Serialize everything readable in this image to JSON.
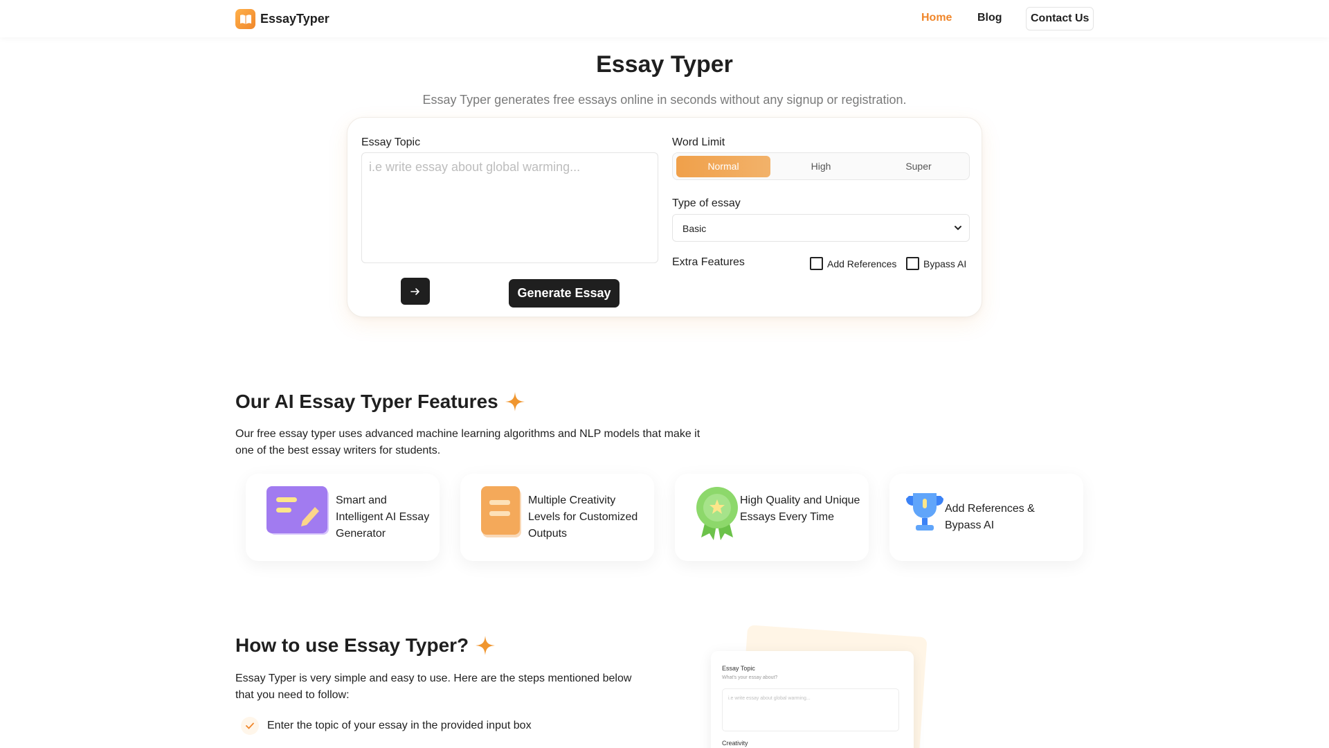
{
  "nav": {
    "brand": "EssayTyper",
    "links": {
      "home": "Home",
      "blog": "Blog",
      "contact": "Contact Us"
    }
  },
  "hero": {
    "title": "Essay Typer",
    "subtitle": "Essay Typer generates free essays online in seconds without any signup or registration."
  },
  "form": {
    "topic_label": "Essay Topic",
    "topic_placeholder": "i.e write essay about global warming...",
    "generate_label": "Generate Essay",
    "word_limit_label": "Word Limit",
    "word_limit_options": [
      "Normal",
      "High",
      "Super"
    ],
    "word_limit_selected": "Normal",
    "type_label": "Type of essay",
    "type_value": "Basic",
    "extra_label": "Extra Features",
    "extra_options": [
      "Add References",
      "Bypass AI"
    ]
  },
  "features": {
    "title": "Our AI Essay Typer Features",
    "description": "Our free essay typer uses advanced machine learning algorithms and NLP models that make it one of the best essay writers for students.",
    "cards": [
      {
        "text": "Smart and Intelligent AI Essay Generator",
        "icon": "document-edit-icon"
      },
      {
        "text": "Multiple Creativity Levels for Customized Outputs",
        "icon": "document-stack-icon"
      },
      {
        "text": "High Quality and Unique Essays Every Time",
        "icon": "award-medal-icon"
      },
      {
        "text": "Add References & Bypass AI",
        "icon": "trophy-icon"
      }
    ]
  },
  "howto": {
    "title": "How to use Essay Typer?",
    "description": "Essay Typer is very simple and easy to use. Here are the steps mentioned below that you need to follow:",
    "steps": [
      "Enter the topic of your essay in the provided input box"
    ],
    "preview": {
      "topic_label": "Essay Topic",
      "topic_sub": "What's your essay about?",
      "placeholder": "i.e write essay about global warming...",
      "creativity_label": "Creativity"
    }
  },
  "colors": {
    "accent": "#f0862a",
    "dark": "#1f1f1f"
  }
}
